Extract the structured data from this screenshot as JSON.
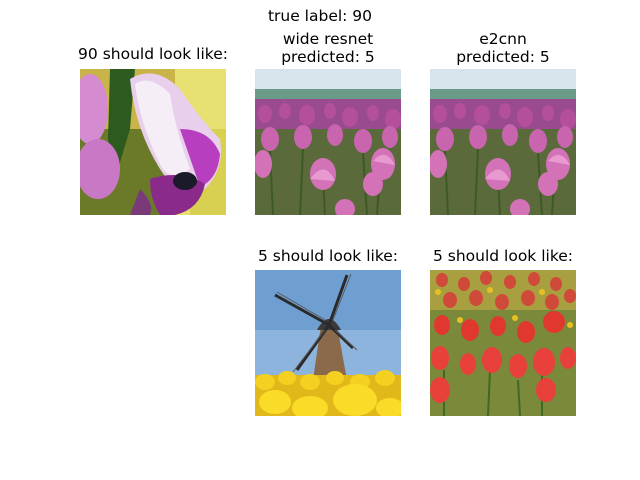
{
  "suptitle": "true label: 90",
  "panels": {
    "true_example": {
      "title": "90 should look like:"
    },
    "wide_resnet": {
      "title_line1": "wide resnet",
      "title_line2": "predicted: 5"
    },
    "e2cnn": {
      "title_line1": "e2cnn",
      "title_line2": "predicted: 5"
    },
    "wide_resnet_pred_example": {
      "title": "5 should look like:"
    },
    "e2cnn_pred_example": {
      "title": "5 should look like:"
    }
  }
}
